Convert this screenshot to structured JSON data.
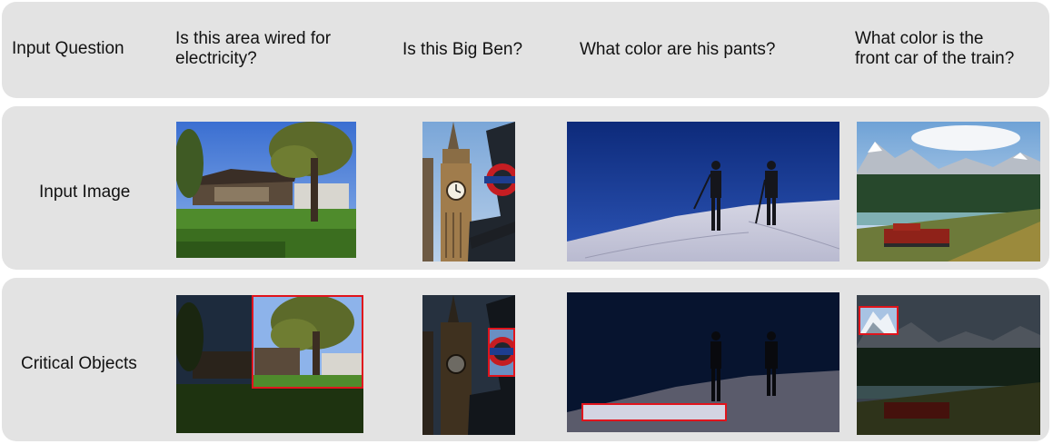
{
  "rows": {
    "question_label": "Input Question",
    "image_label": "Input Image",
    "critical_label": "Critical Objects"
  },
  "questions": [
    {
      "line1": "Is this area wired for",
      "line2": "electricity?"
    },
    {
      "line1": "Is this Big Ben?",
      "line2": ""
    },
    {
      "line1": "What color are his pants?",
      "line2": ""
    },
    {
      "line1": "What color is the",
      "line2": "front car of the train?"
    }
  ],
  "colors": {
    "band": "#e3e3e3",
    "highlight_box": "#e0141c"
  }
}
